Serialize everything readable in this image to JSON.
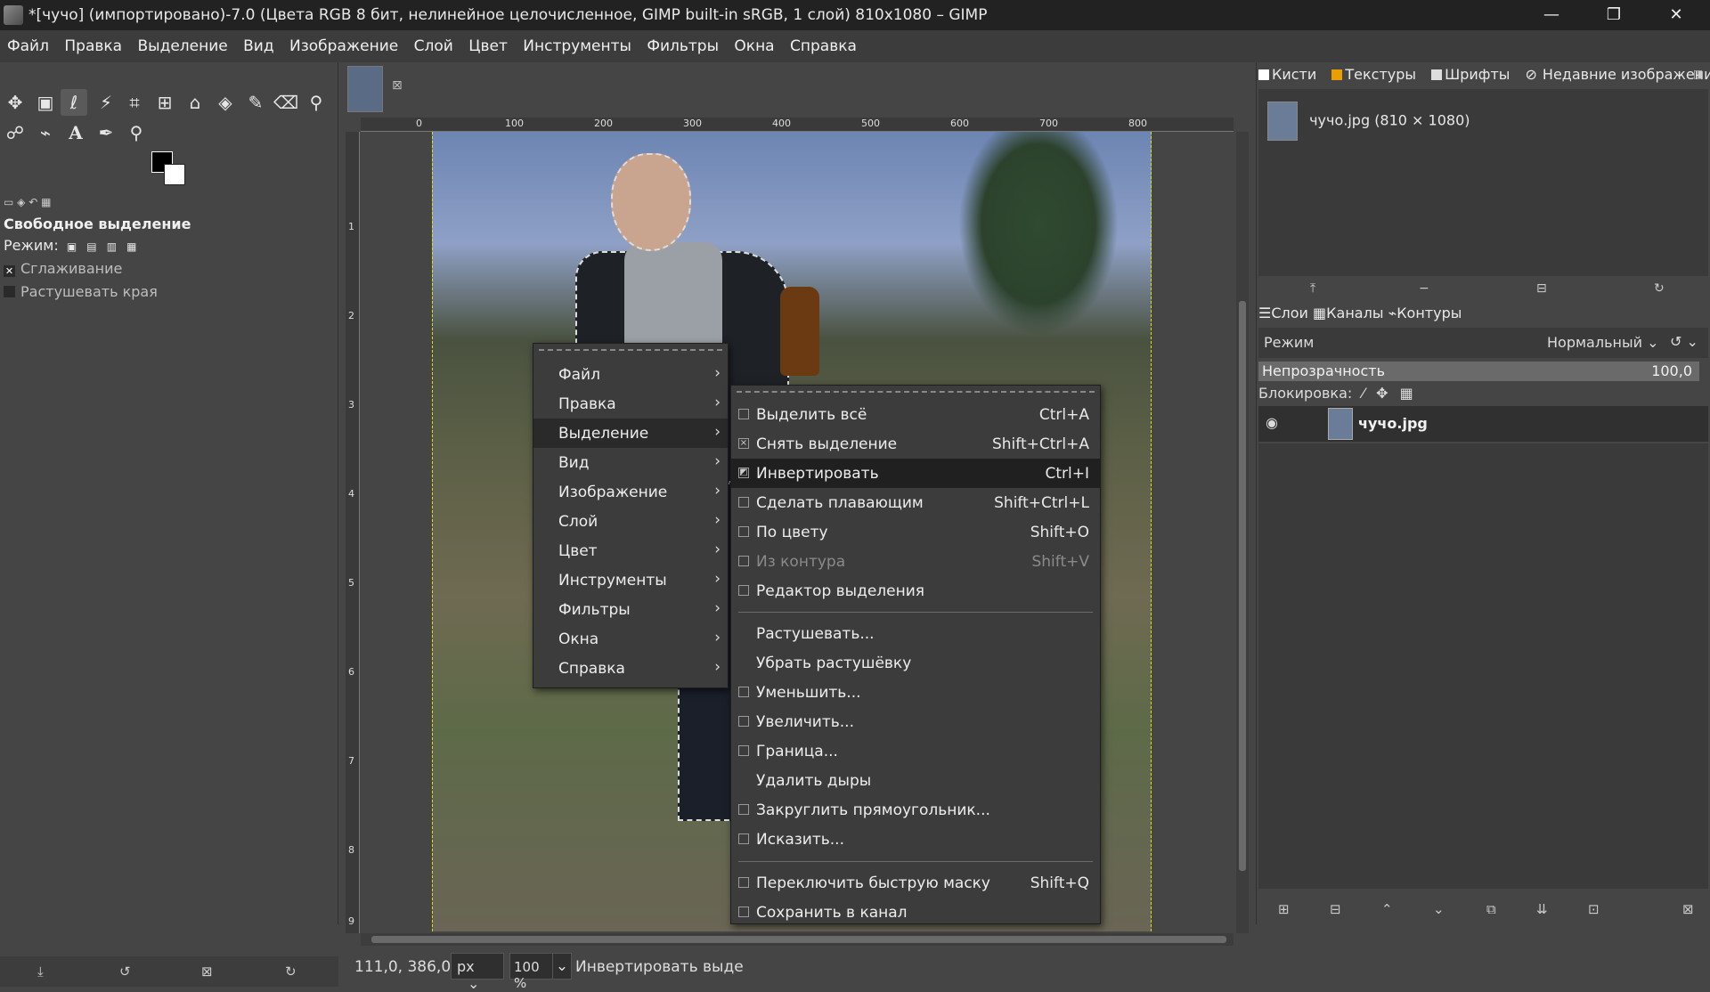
{
  "window": {
    "title": "*[чучо] (импортировано)-7.0 (Цвета RGB 8 бит, нелинейное целочисленное, GIMP built-in sRGB, 1 слой) 810x1080 – GIMP",
    "minimize": "—",
    "maximize": "❐",
    "close": "✕"
  },
  "menubar": [
    "Файл",
    "Правка",
    "Выделение",
    "Вид",
    "Изображение",
    "Слой",
    "Цвет",
    "Инструменты",
    "Фильтры",
    "Окна",
    "Справка"
  ],
  "toolbox": {
    "tool_options_title": "Свободное выделение",
    "mode_label": "Режим:",
    "antialias_label": "Сглаживание",
    "feather_label": "Растушевать края"
  },
  "canvas": {
    "ruler_h": [
      "0",
      "100",
      "200",
      "300",
      "400",
      "500",
      "600",
      "700",
      "800"
    ],
    "ruler_v": [
      "1",
      "2",
      "3",
      "4",
      "5",
      "6",
      "7",
      "8",
      "9"
    ]
  },
  "statusbar": {
    "coords": "111,0, 386,0",
    "unit": "px",
    "zoom": "100 %",
    "message": "Инвертировать выде"
  },
  "context_menu": {
    "items": [
      {
        "label": "Файл"
      },
      {
        "label": "Правка"
      },
      {
        "label": "Выделение"
      },
      {
        "label": "Вид"
      },
      {
        "label": "Изображение"
      },
      {
        "label": "Слой"
      },
      {
        "label": "Цвет"
      },
      {
        "label": "Инструменты"
      },
      {
        "label": "Фильтры"
      },
      {
        "label": "Окна"
      },
      {
        "label": "Справка"
      }
    ]
  },
  "select_submenu": {
    "group1": [
      {
        "label": "Выделить всё",
        "shortcut": "Ctrl+A"
      },
      {
        "label": "Снять выделение",
        "shortcut": "Shift+Ctrl+A"
      },
      {
        "label": "Инвертировать",
        "shortcut": "Ctrl+I"
      },
      {
        "label": "Сделать плавающим",
        "shortcut": "Shift+Ctrl+L"
      },
      {
        "label": "По цвету",
        "shortcut": "Shift+O"
      },
      {
        "label": "Из контура",
        "shortcut": "Shift+V"
      },
      {
        "label": "Редактор выделения",
        "shortcut": ""
      }
    ],
    "group2": [
      {
        "label": "Растушевать..."
      },
      {
        "label": "Убрать растушёвку"
      },
      {
        "label": "Уменьшить..."
      },
      {
        "label": "Увеличить..."
      },
      {
        "label": "Граница..."
      },
      {
        "label": "Удалить дыры"
      },
      {
        "label": "Закруглить прямоугольник..."
      },
      {
        "label": "Исказить..."
      }
    ],
    "group3": [
      {
        "label": "Переключить быструю маску",
        "shortcut": "Shift+Q"
      },
      {
        "label": "Сохранить в канал",
        "shortcut": ""
      }
    ]
  },
  "dock": {
    "top_tabs": [
      "Кисти",
      "Текстуры",
      "Шрифты",
      "Недавние изображения"
    ],
    "recent_item": "чучо.jpg (810 × 1080)",
    "layer_tabs": [
      "Слои",
      "Каналы",
      "Контуры"
    ],
    "mode_label": "Режим",
    "mode_value": "Нормальный",
    "opacity_label": "Непрозрачность",
    "opacity_value": "100,0",
    "lock_label": "Блокировка:",
    "layer_name": "чучо.jpg"
  }
}
